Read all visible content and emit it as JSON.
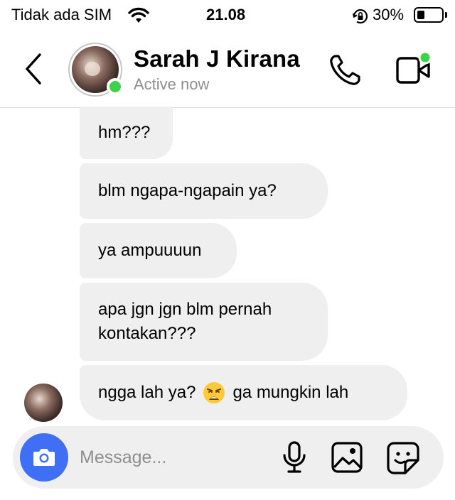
{
  "status_bar": {
    "carrier": "Tidak ada SIM",
    "time": "21.08",
    "battery_percent_text": "30%",
    "battery_level": 0.3,
    "icons": [
      "wifi-icon",
      "orientation-lock-icon",
      "battery-icon"
    ]
  },
  "header": {
    "contact_name": "Sarah J Kirana",
    "status": "Active now",
    "online_color": "#3cd24a",
    "icons": [
      "back-chevron-icon",
      "phone-icon",
      "video-camera-icon"
    ]
  },
  "messages": [
    {
      "text": "hm???"
    },
    {
      "text": "blm ngapa-ngapain ya?"
    },
    {
      "text": "ya ampuuuun"
    },
    {
      "text": "apa jgn jgn blm pernah\nkontakan???"
    },
    {
      "text_before": "ngga lah ya?",
      "emoji": "weary-face-emoji",
      "text_after": "ga mungkin lah"
    }
  ],
  "composer": {
    "placeholder": "Message...",
    "camera_color": "#3f6ff5",
    "icons": [
      "camera-icon",
      "microphone-icon",
      "image-icon",
      "sticker-icon"
    ]
  },
  "colors": {
    "bubble": "#efefef",
    "muted_text": "#8e8e8e"
  }
}
